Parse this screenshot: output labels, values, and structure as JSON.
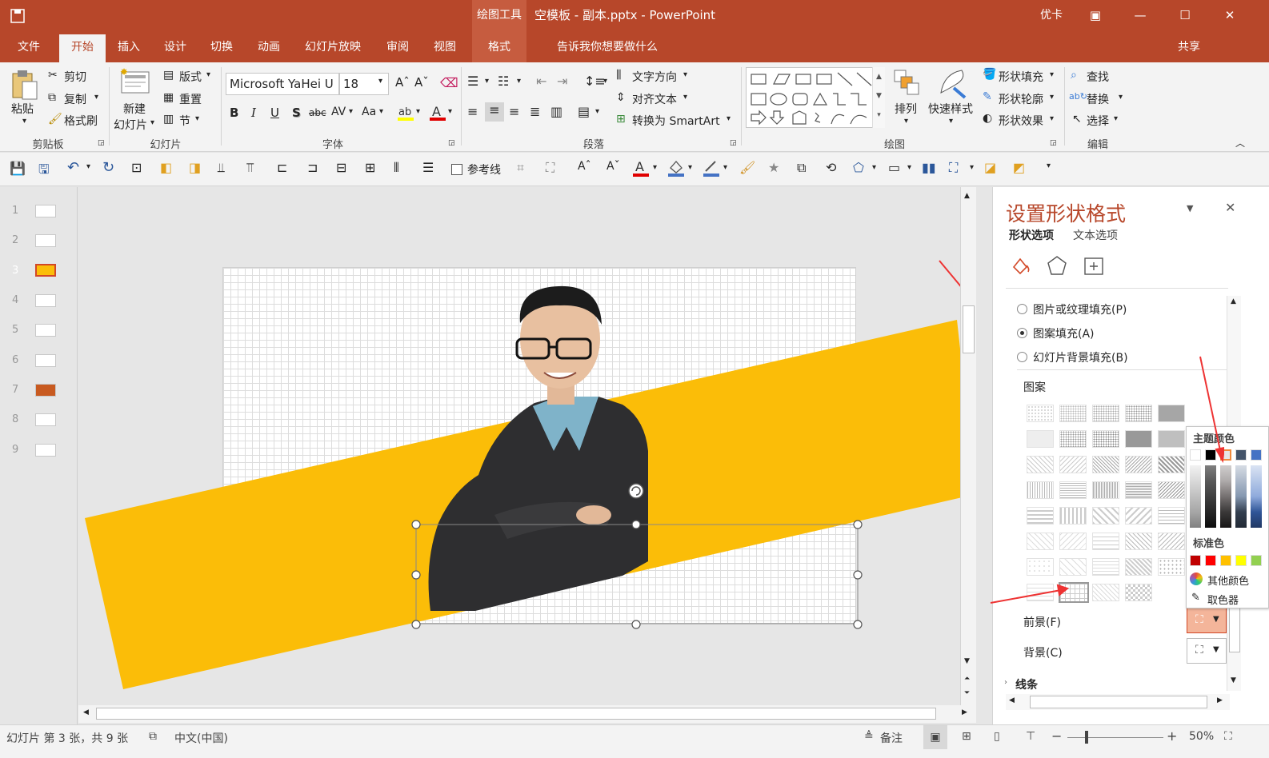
{
  "titlebar": {
    "context_tab": "绘图工具",
    "title": "空模板 - 副本.pptx  -  PowerPoint",
    "user": "优卡"
  },
  "tabs": [
    "文件",
    "开始",
    "插入",
    "设计",
    "切换",
    "动画",
    "幻灯片放映",
    "审阅",
    "视图",
    "格式"
  ],
  "tell_me": "告诉我你想要做什么",
  "share": "共享",
  "ribbon": {
    "clipboard": {
      "paste": "粘贴",
      "cut": "剪切",
      "copy": "复制",
      "format_painter": "格式刷",
      "label": "剪贴板"
    },
    "slides": {
      "new_slide_1": "新建",
      "new_slide_2": "幻灯片",
      "layout": "版式",
      "reset": "重置",
      "section": "节",
      "label": "幻灯片"
    },
    "font": {
      "name": "Microsoft YaHei U",
      "size": "18",
      "bold": "B",
      "italic": "I",
      "underline": "U",
      "shadow": "S",
      "strike": "abc",
      "spacing": "AV",
      "case": "Aa",
      "label": "字体"
    },
    "paragraph": {
      "text_dir": "文字方向",
      "align_text": "对齐文本",
      "smartart": "转换为 SmartArt",
      "label": "段落"
    },
    "drawing": {
      "arrange": "排列",
      "quick_styles": "快速样式",
      "fill": "形状填充",
      "outline": "形状轮廓",
      "effects": "形状效果",
      "label": "绘图"
    },
    "editing": {
      "find": "查找",
      "replace": "替换",
      "select": "选择",
      "label": "编辑"
    }
  },
  "qat": {
    "guides": "参考线"
  },
  "slide_numbers": [
    "1",
    "2",
    "3",
    "4",
    "5",
    "6",
    "7",
    "8",
    "9"
  ],
  "current_slide": 3,
  "pane": {
    "title": "设置形状格式",
    "tab_shape": "形状选项",
    "tab_text": "文本选项",
    "fill_options": [
      {
        "label": "图片或纹理填充(P)",
        "checked": false
      },
      {
        "label": "图案填充(A)",
        "checked": true
      },
      {
        "label": "幻灯片背景填充(B)",
        "checked": false
      }
    ],
    "pattern_label": "图案",
    "foreground": "前景(F)",
    "background": "背景(C)",
    "line_section": "线条"
  },
  "color_popup": {
    "theme_label": "主题颜色",
    "standard_label": "标准色",
    "more_colors": "其他颜色",
    "eyedropper": "取色器",
    "theme_colors": [
      "#ffffff",
      "#000000",
      "#e7e6e6",
      "#44546a",
      "#4472c4"
    ],
    "standard_colors": [
      "#c00000",
      "#ff0000",
      "#ffc000",
      "#ffff00",
      "#92d050"
    ]
  },
  "colors": {
    "accent": "#b7472a",
    "band": "#fbbd08",
    "handle": "#555555"
  },
  "status": {
    "slide_info": "幻灯片 第 3 张，共 9 张",
    "language": "中文(中国)",
    "notes": "备注",
    "zoom": "50%"
  }
}
